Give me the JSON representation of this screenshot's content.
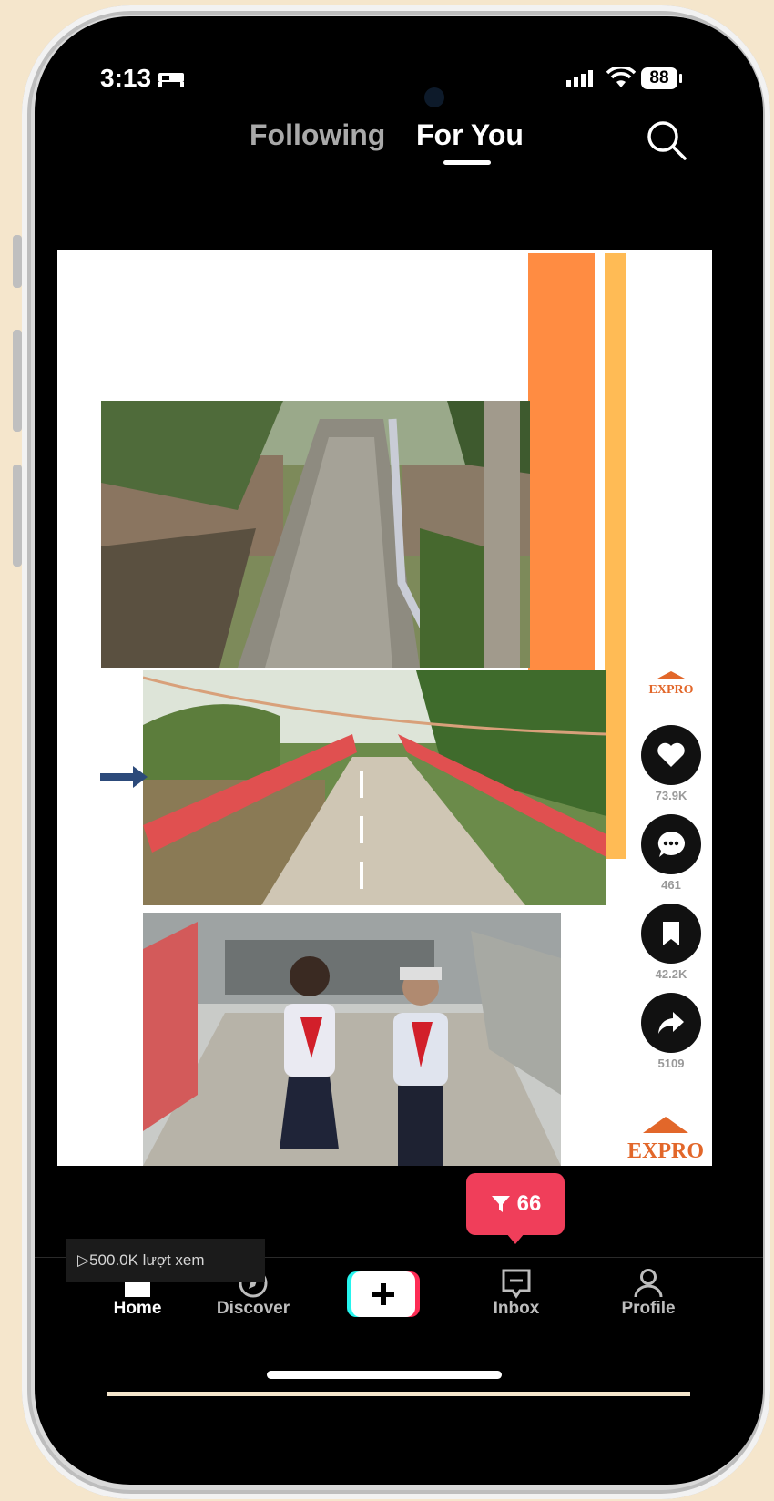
{
  "status_bar": {
    "time": "3:13",
    "battery": "88"
  },
  "top_tabs": {
    "following": "Following",
    "for_you": "For You"
  },
  "actions": {
    "likes": "73.9K",
    "comments": "461",
    "saves": "42.2K",
    "shares": "5109"
  },
  "brand": {
    "name": "EXPRO"
  },
  "popup": {
    "count": "66"
  },
  "views_label": "▷500.0K lượt xem",
  "nav": {
    "home": "Home",
    "discover": "Discover",
    "inbox": "Inbox",
    "profile": "Profile"
  },
  "colors": {
    "orange_bar": "#ff8c42",
    "yellow_bar": "#ffbb55",
    "popup_bg": "#f03e5a",
    "plus_cyan": "#25f4ee",
    "plus_pink": "#fe2c55"
  }
}
